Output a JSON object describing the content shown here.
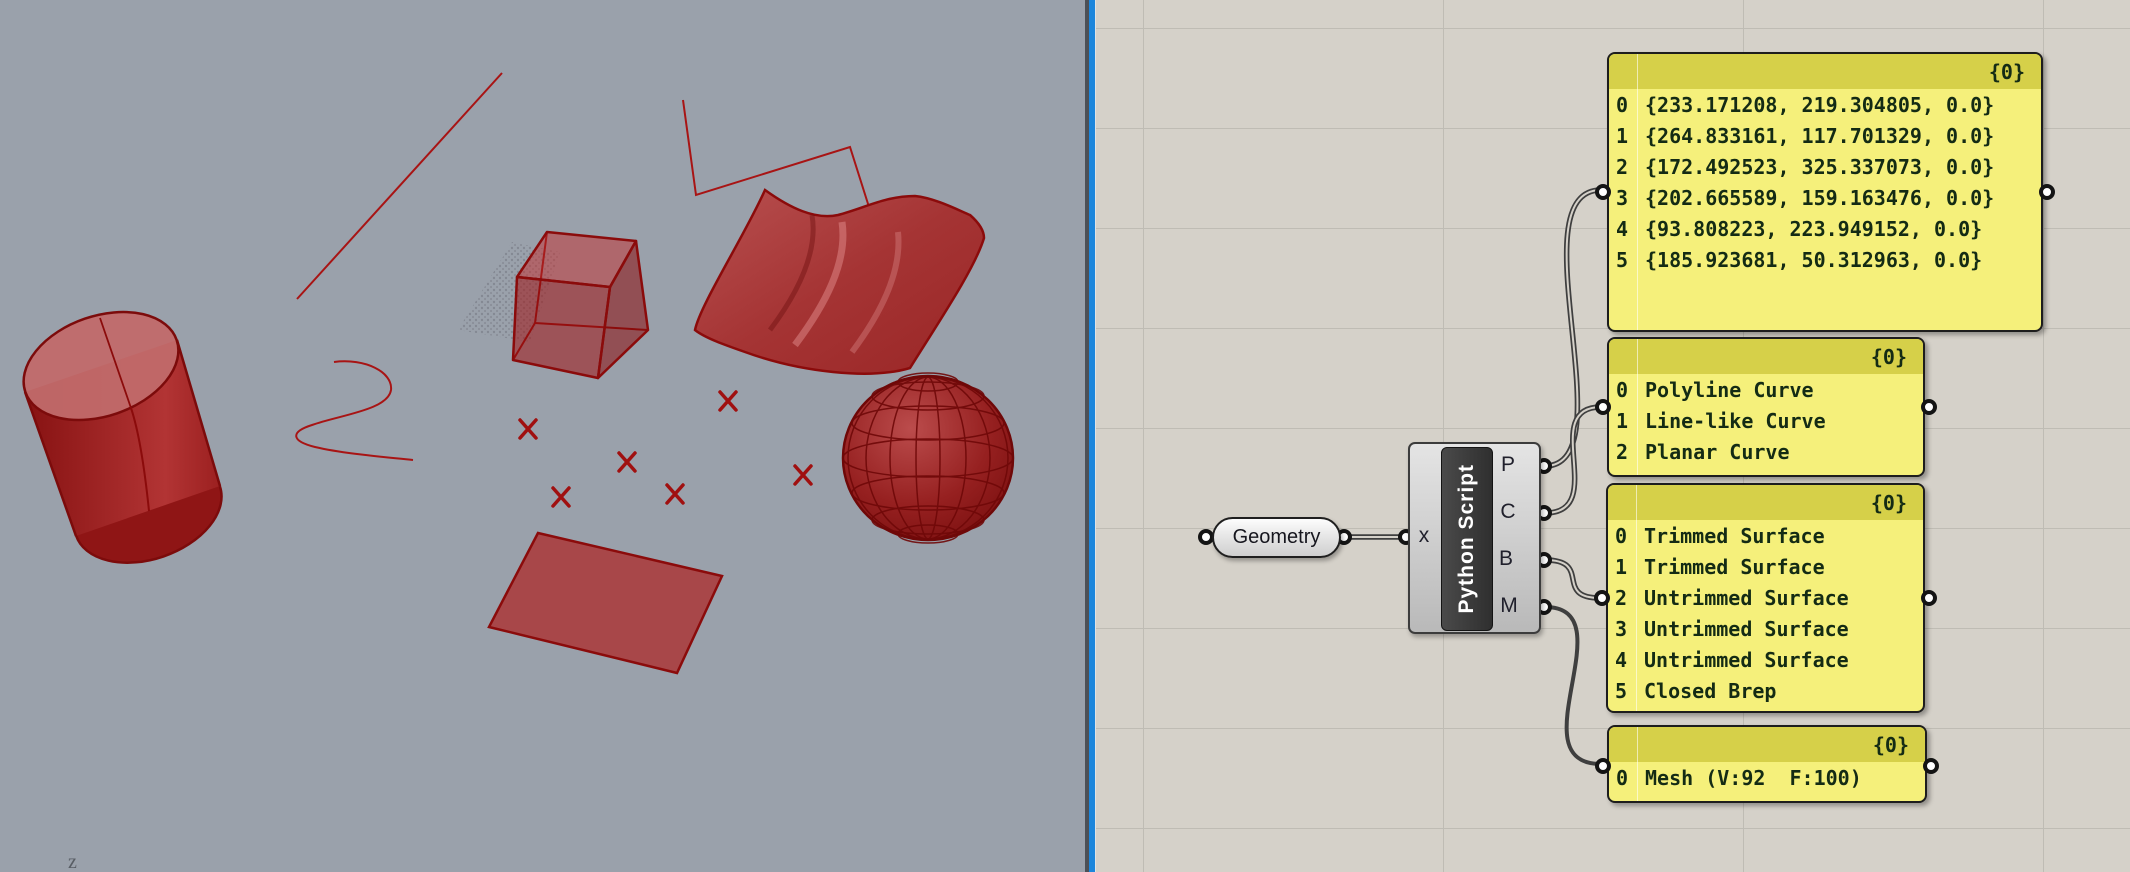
{
  "rhino_viewport": {
    "axis_label": "z",
    "colors": {
      "background": "#9aa1ab",
      "geometry_red": "#a02020",
      "edge_red": "#8b0b0b"
    },
    "contents": "red preview geometry: cylinder, line, polyline, sine curve, hatched plane, box, wavy surface, mesh sphere, rectangle surface, 6 point markers"
  },
  "grasshopper": {
    "colors": {
      "canvas": "#d5d1c9",
      "grid_line": "#bfbcb4",
      "panel_yellow": "#f5f07b",
      "panel_header": "#d6d049",
      "divider_blue": "#1c86dc"
    },
    "geometry_param": {
      "label": "Geometry"
    },
    "python_component": {
      "title": "Python Script",
      "input": {
        "label": "x"
      },
      "outputs": [
        {
          "label": "P"
        },
        {
          "label": "C"
        },
        {
          "label": "B"
        },
        {
          "label": "M"
        }
      ]
    },
    "panels": [
      {
        "header": "{0}",
        "rows": [
          {
            "index": "0",
            "value": "{233.171208, 219.304805, 0.0}"
          },
          {
            "index": "1",
            "value": "{264.833161, 117.701329, 0.0}"
          },
          {
            "index": "2",
            "value": "{172.492523, 325.337073, 0.0}"
          },
          {
            "index": "3",
            "value": "{202.665589, 159.163476, 0.0}"
          },
          {
            "index": "4",
            "value": "{93.808223, 223.949152, 0.0}"
          },
          {
            "index": "5",
            "value": "{185.923681, 50.312963, 0.0}"
          }
        ]
      },
      {
        "header": "{0}",
        "rows": [
          {
            "index": "0",
            "value": "Polyline Curve"
          },
          {
            "index": "1",
            "value": "Line-like Curve"
          },
          {
            "index": "2",
            "value": "Planar Curve"
          }
        ]
      },
      {
        "header": "{0}",
        "rows": [
          {
            "index": "0",
            "value": "Trimmed Surface"
          },
          {
            "index": "1",
            "value": "Trimmed Surface"
          },
          {
            "index": "2",
            "value": "Untrimmed Surface"
          },
          {
            "index": "3",
            "value": "Untrimmed Surface"
          },
          {
            "index": "4",
            "value": "Untrimmed Surface"
          },
          {
            "index": "5",
            "value": "Closed Brep"
          }
        ]
      },
      {
        "header": "{0}",
        "rows": [
          {
            "index": "0",
            "value": "Mesh (V:92  F:100)"
          }
        ]
      }
    ]
  }
}
